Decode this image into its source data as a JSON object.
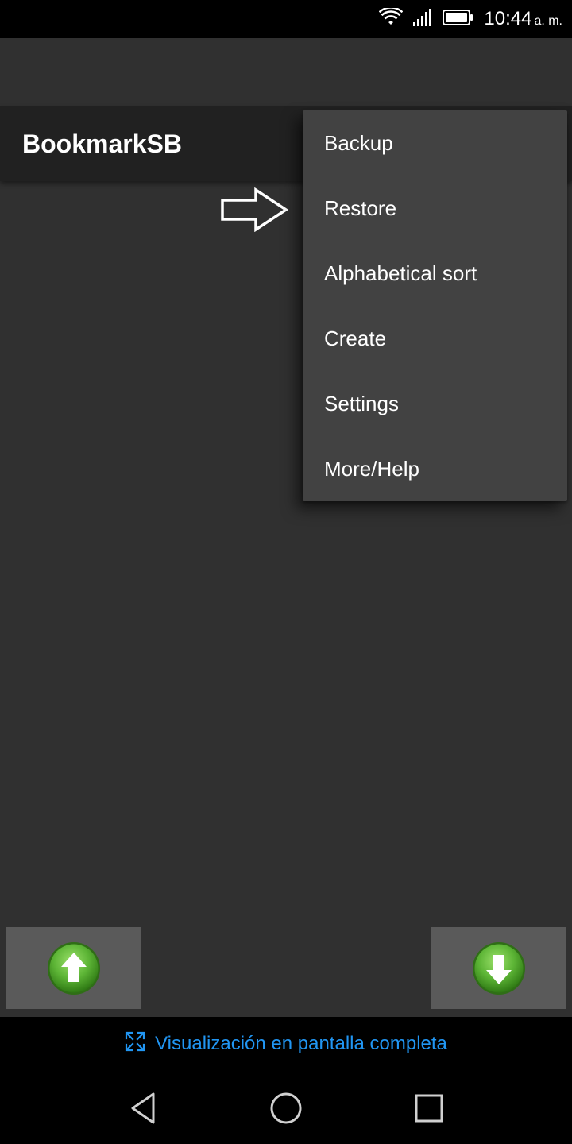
{
  "status_bar": {
    "time": "10:44",
    "ampm": "a. m.",
    "icons": [
      "wifi-icon",
      "signal-icon",
      "battery-icon"
    ]
  },
  "app_bar": {
    "title": "BookmarkSB"
  },
  "menu": {
    "items": [
      {
        "label": "Backup"
      },
      {
        "label": "Restore"
      },
      {
        "label": "Alphabetical sort"
      },
      {
        "label": "Create"
      },
      {
        "label": "Settings"
      },
      {
        "label": "More/Help"
      }
    ]
  },
  "bottom_buttons": {
    "up_icon": "arrow-up-icon",
    "down_icon": "arrow-down-icon",
    "accent": "#5db536"
  },
  "system": {
    "fullscreen_label": "Visualización en pantalla completa",
    "fullscreen_color": "#2196f3",
    "keys": [
      "back-icon",
      "home-icon",
      "recents-icon"
    ]
  }
}
